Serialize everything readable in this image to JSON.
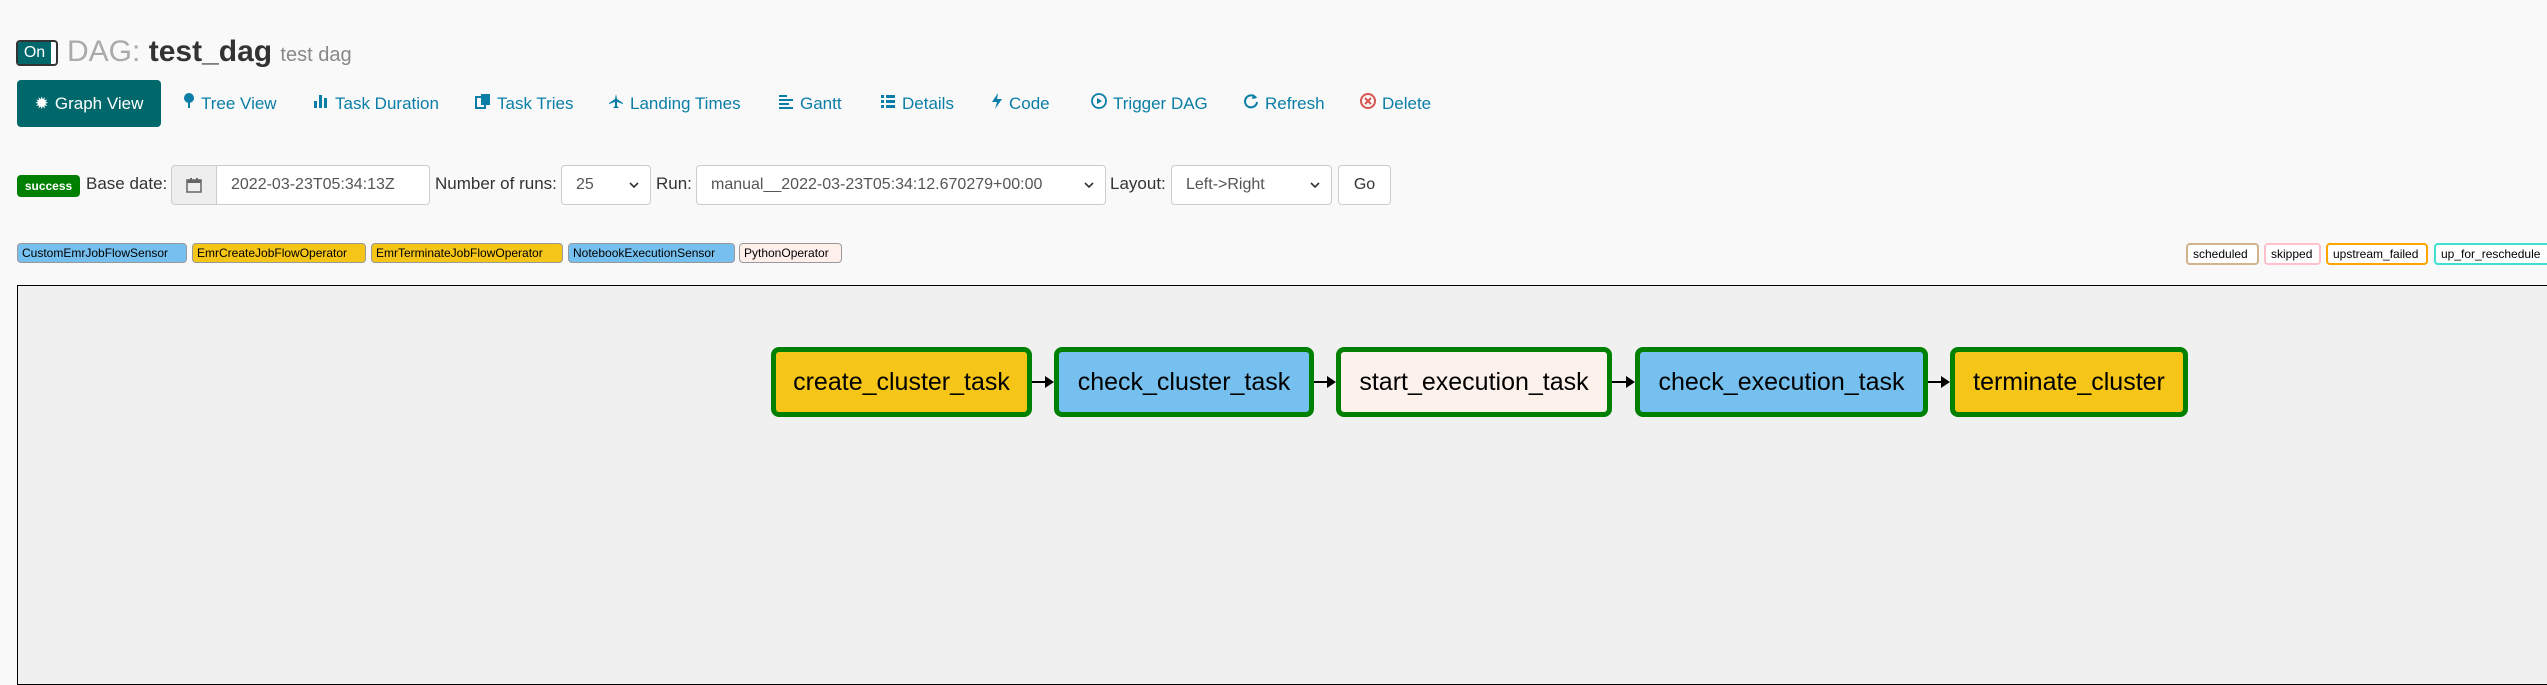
{
  "header": {
    "toggle_label": "On",
    "dag_label": "DAG:",
    "dag_id": "test_dag",
    "dag_description": "test dag"
  },
  "nav": {
    "active_tab": {
      "label": "Graph View",
      "icon": "gear-icon"
    },
    "tabs": [
      {
        "label": "Tree View",
        "icon": "tree-icon"
      },
      {
        "label": "Task Duration",
        "icon": "bar-chart-icon"
      },
      {
        "label": "Task Tries",
        "icon": "copy-icon"
      },
      {
        "label": "Landing Times",
        "icon": "plane-icon"
      },
      {
        "label": "Gantt",
        "icon": "align-left-icon"
      },
      {
        "label": "Details",
        "icon": "list-icon"
      },
      {
        "label": "Code",
        "icon": "flash-icon"
      },
      {
        "label": "Trigger DAG",
        "icon": "play-circle-icon"
      },
      {
        "label": "Refresh",
        "icon": "refresh-icon"
      },
      {
        "label": "Delete",
        "icon": "delete-icon"
      }
    ]
  },
  "controls": {
    "status_badge": "success",
    "base_date_label": "Base date:",
    "base_date_value": "2022-03-23T05:34:13Z",
    "num_runs_label": "Number of runs:",
    "num_runs_value": "25",
    "run_label": "Run:",
    "run_value": "manual__2022-03-23T05:34:12.670279+00:00",
    "layout_label": "Layout:",
    "layout_value": "Left->Right",
    "go_label": "Go"
  },
  "operators": [
    {
      "label": "CustomEmrJobFlowSensor",
      "color": "#75c0ef"
    },
    {
      "label": "EmrCreateJobFlowOperator",
      "color": "#f5c518"
    },
    {
      "label": "EmrTerminateJobFlowOperator",
      "color": "#f5c518"
    },
    {
      "label": "NotebookExecutionSensor",
      "color": "#75c0ef"
    },
    {
      "label": "PythonOperator",
      "color": "#ffefeb"
    }
  ],
  "states": [
    {
      "label": "scheduled",
      "color": "#d2b48c"
    },
    {
      "label": "skipped",
      "color": "#ffc0cb"
    },
    {
      "label": "upstream_failed",
      "color": "#ffa500"
    },
    {
      "label": "up_for_reschedule",
      "color": "#40e0d0"
    }
  ],
  "graph": {
    "nodes": [
      {
        "label": "create_cluster_task",
        "color": "#f5c518"
      },
      {
        "label": "check_cluster_task",
        "color": "#75c0ef"
      },
      {
        "label": "start_execution_task",
        "color": "#fdf1eb"
      },
      {
        "label": "check_execution_task",
        "color": "#75c0ef"
      },
      {
        "label": "terminate_cluster",
        "color": "#f5c518"
      }
    ],
    "border_color": "#008000"
  }
}
